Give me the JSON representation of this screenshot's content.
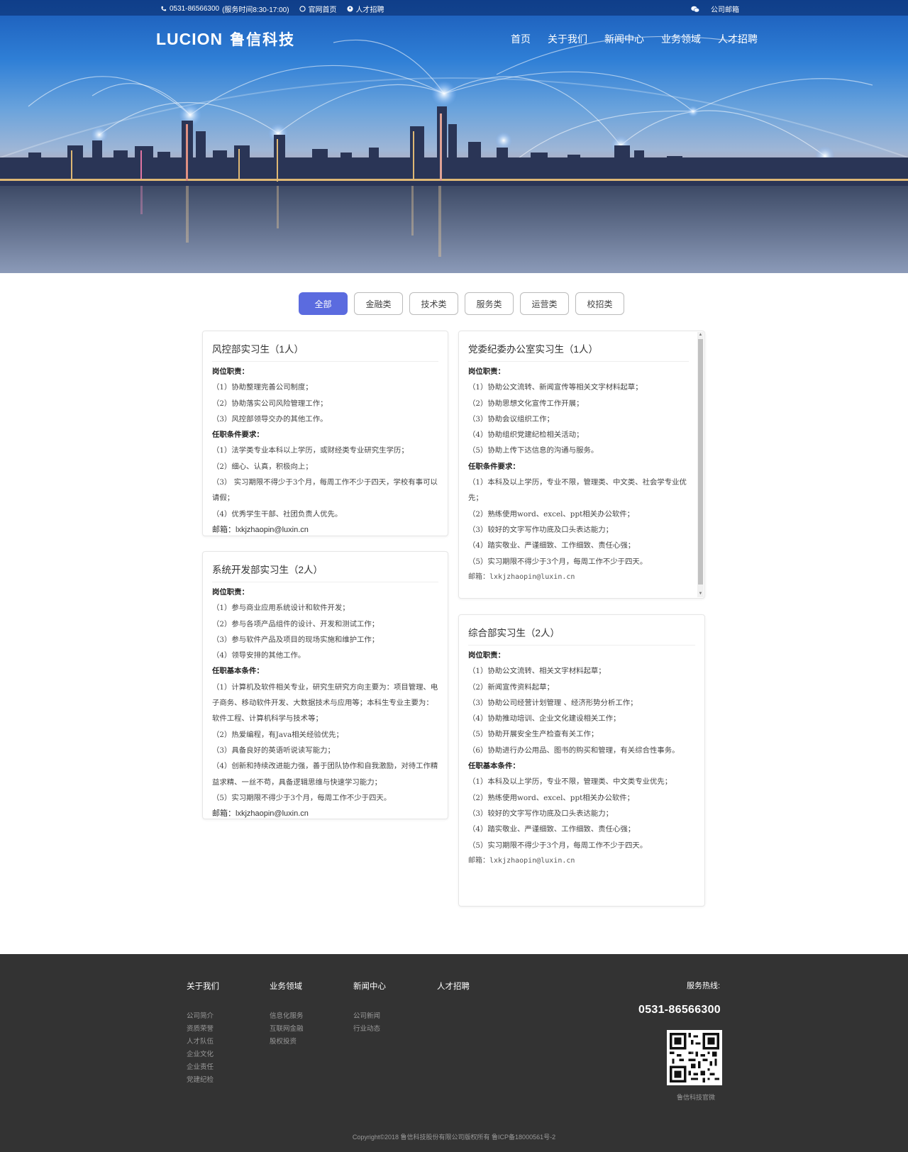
{
  "topbar": {
    "phone": "0531-86566300",
    "service_hours": "(服务时间8:30-17:00)",
    "home_link": "官网首页",
    "jobs_link": "人才招聘",
    "mail_link": "公司邮箱"
  },
  "header": {
    "logo_en": "LUCION",
    "logo_cn": "鲁信科技",
    "nav": [
      "首页",
      "关于我们",
      "新闻中心",
      "业务领域",
      "人才招聘"
    ]
  },
  "tabs": [
    {
      "label": "全部",
      "active": true
    },
    {
      "label": "金融类",
      "active": false
    },
    {
      "label": "技术类",
      "active": false
    },
    {
      "label": "服务类",
      "active": false
    },
    {
      "label": "运营类",
      "active": false
    },
    {
      "label": "校招类",
      "active": false
    }
  ],
  "jobs": {
    "risk": {
      "title": "风控部实习生（1人）",
      "h1": "岗位职责：",
      "duties": [
        "（1）协助整理完善公司制度；",
        "（2）协助落实公司风险管理工作；",
        "（3）风控部领导交办的其他工作。"
      ],
      "h2": "任职条件要求：",
      "reqs": [
        "（1）法学类专业本科以上学历，或财经类专业研究生学历；",
        "（2）细心、认真，积极向上；",
        "（3） 实习期限不得少于3个月，每周工作不少于四天，学校有事可以请假；",
        "（4）优秀学生干部、社团负责人优先。"
      ],
      "email": "邮箱：lxkjzhaopin@luxin.cn"
    },
    "party": {
      "title": "党委纪委办公室实习生（1人）",
      "h1": "岗位职责：",
      "duties": [
        "（1）协助公文流转、新闻宣传等相关文字材料起草；",
        "（2）协助思想文化宣传工作开展；",
        "（3）协助会议组织工作；",
        "（4）协助组织党建纪检相关活动；",
        "（5）协助上传下达信息的沟通与服务。"
      ],
      "h2": "任职条件要求：",
      "reqs": [
        "（1）本科及以上学历，专业不限，管理类、中文类、社会学专业优先；",
        "（2）熟练使用word、excel、ppt相关办公软件；",
        "（3）较好的文字写作功底及口头表达能力；",
        "（4）踏实敬业、严谨细致、工作细致、责任心强；",
        "（5）实习期限不得少于3个月，每周工作不少于四天。"
      ],
      "email": "邮箱：lxkjzhaopin@luxin.cn"
    },
    "sysdev": {
      "title": "系统开发部实习生（2人）",
      "h1": "岗位职责：",
      "duties": [
        "（1）参与商业应用系统设计和软件开发；",
        "（2）参与各项产品组件的设计、开发和测试工作；",
        "（3）参与软件产品及项目的现场实施和维护工作；",
        "（4）领导安排的其他工作。"
      ],
      "h2": "任职基本条件：",
      "reqs": [
        "（1）计算机及软件相关专业，研究生研究方向主要为：项目管理、电子商务、移动软件开发、大数据技术与应用等；本科生专业主要为：软件工程、计算机科学与技术等；",
        "（2）热爱编程，有Java相关经验优先；",
        "（3）具备良好的英语听说读写能力；",
        "（4）创新和持续改进能力强，善于团队协作和自我激励，对待工作精益求精、一丝不苟，具备逻辑思维与快速学习能力；",
        "（5）实习期限不得少于3个月，每周工作不少于四天。"
      ],
      "email": "邮箱：lxkjzhaopin@luxin.cn"
    },
    "general": {
      "title": "综合部实习生（2人）",
      "h1": "岗位职责：",
      "duties": [
        "（1）协助公文流转、相关文字材料起草；",
        "（2）新闻宣传资料起草；",
        "（3）协助公司经营计划管理 、经济形势分析工作；",
        "（4）协助推动培训、企业文化建设相关工作；",
        "（5）协助开展安全生产检查有关工作；",
        "（6）协助进行办公用品、图书的购买和管理，有关综合性事务。"
      ],
      "h2": "任职基本条件：",
      "reqs": [
        "（1）本科及以上学历，专业不限，管理类、中文类专业优先；",
        "（2）熟练使用word、excel、ppt相关办公软件；",
        "（3）较好的文字写作功底及口头表达能力；",
        "（4）踏实敬业、严谨细致、工作细致、责任心强；",
        "（5）实习期限不得少于3个月，每周工作不少于四天。"
      ],
      "email": "邮箱：lxkjzhaopin@luxin.cn"
    }
  },
  "footer": {
    "columns": [
      {
        "heading": "关于我们",
        "links": [
          "公司简介",
          "资质荣誉",
          "人才队伍",
          "企业文化",
          "企业责任",
          "党建纪检"
        ]
      },
      {
        "heading": "业务领域",
        "links": [
          "信息化服务",
          "互联网金融",
          "股权投资"
        ]
      },
      {
        "heading": "新闻中心",
        "links": [
          "公司新闻",
          "行业动态"
        ]
      },
      {
        "heading": "人才招聘",
        "links": []
      }
    ],
    "hotline_label": "服务热线:",
    "hotline_number": "0531-86566300",
    "qr_caption": "鲁信科技官微",
    "copyright": "Copyright©2018 鲁信科技股份有限公司版权所有 鲁ICP备18000561号-2"
  },
  "colors": {
    "accent": "#5b6bdf",
    "footer_bg": "#333333"
  }
}
